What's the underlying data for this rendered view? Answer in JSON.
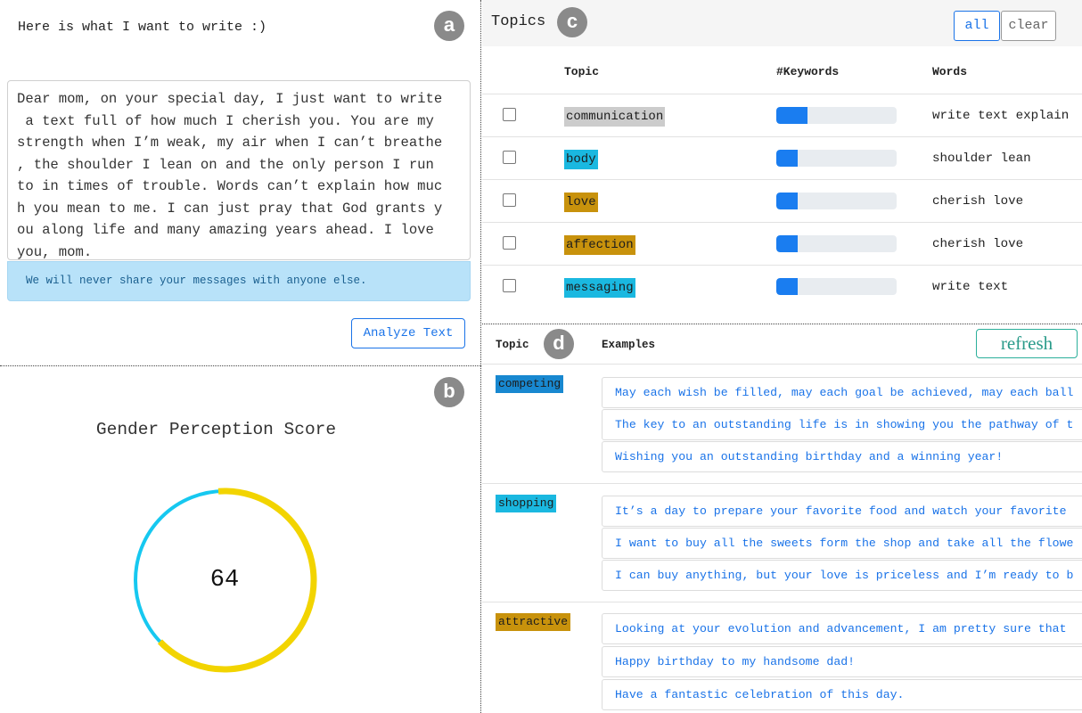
{
  "colors": {
    "accent_blue": "#1a73e8",
    "bar_blue": "#1a7df0",
    "gauge_cyan": "#16c8f0",
    "gauge_yellow": "#f2d400",
    "refresh_teal": "#2baf9a",
    "badge_gray": "#8a8a8a"
  },
  "panel_a": {
    "badge": "a",
    "heading": "Here is what I want to write :)",
    "text": "Dear mom, on your special day, I just want to write\n a text full of how much I cherish you. You are my\nstrength when I’m weak, my air when I can’t breathe\n, the shoulder I lean on and the only person I run\nto in times of trouble. Words can’t explain how muc\nh you mean to me. I can just pray that God grants y\nou along life and many amazing years ahead. I love\nyou, mom.",
    "notice": "We will never share your messages with anyone else.",
    "analyze_button": "Analyze Text"
  },
  "panel_b": {
    "badge": "b",
    "title": "Gender Perception Score",
    "score": "64",
    "score_fraction": 0.64
  },
  "panel_c": {
    "badge": "c",
    "title": "Topics",
    "all_button": "all",
    "clear_button": "clear",
    "columns": {
      "topic": "Topic",
      "keywords": "#Keywords",
      "words": "Words"
    },
    "rows": [
      {
        "topic": "communication",
        "color": "#cccccc",
        "keyword_fraction": 0.26,
        "words": "write text explain"
      },
      {
        "topic": "body",
        "color": "#1ab8e0",
        "keyword_fraction": 0.18,
        "words": "shoulder lean"
      },
      {
        "topic": "love",
        "color": "#c8920c",
        "keyword_fraction": 0.18,
        "words": "cherish love"
      },
      {
        "topic": "affection",
        "color": "#c8920c",
        "keyword_fraction": 0.18,
        "words": "cherish love"
      },
      {
        "topic": "messaging",
        "color": "#1ab8e0",
        "keyword_fraction": 0.18,
        "words": "write text"
      }
    ]
  },
  "panel_d": {
    "badge": "d",
    "col_topic": "Topic",
    "col_examples": "Examples",
    "refresh_button": "refresh",
    "groups": [
      {
        "topic": "competing",
        "color": "#1888d0",
        "examples": [
          "May each wish be filled, may each goal be achieved, may each ball",
          "The key to an outstanding life is in showing you the pathway of t",
          "Wishing you an outstanding birthday and a winning year!"
        ]
      },
      {
        "topic": "shopping",
        "color": "#1ab8e0",
        "examples": [
          "It’s a day to prepare your favorite food and watch your favorite",
          "I want to buy all the sweets form the shop and take all the flowe",
          "I can buy anything, but your love is priceless and I’m ready to b"
        ]
      },
      {
        "topic": "attractive",
        "color": "#c8920c",
        "examples": [
          "Looking at your evolution and advancement, I am pretty sure that",
          "Happy birthday to my handsome dad!",
          "Have a fantastic celebration of this day."
        ]
      }
    ]
  }
}
